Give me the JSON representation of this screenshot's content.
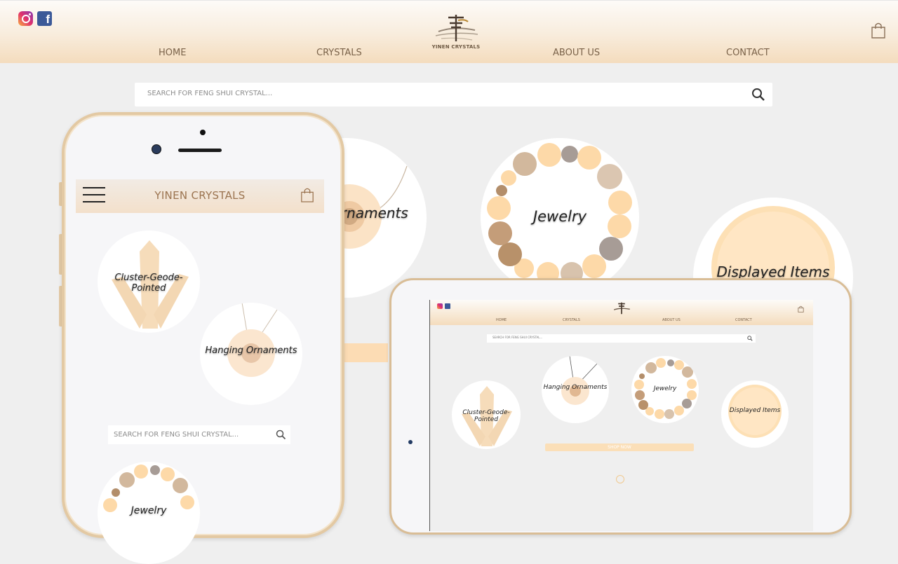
{
  "header": {
    "logo_text": "YINEN CRYSTALS",
    "nav": [
      "HOME",
      "CRYSTALS",
      "ABOUT US",
      "CONTACT"
    ]
  },
  "search": {
    "placeholder": "SEARCH FOR FENG SHUI CRYSTAL..."
  },
  "categories": [
    "Ornaments",
    "Jewelry",
    "Displayed Items"
  ],
  "phone": {
    "title": "YINEN CRYSTALS",
    "categories": [
      "Cluster-Geode-Pointed",
      "Hanging Ornaments",
      "Jewelry"
    ],
    "search_placeholder": "SEARCH FOR FENG SHUI CRYSTAL..."
  },
  "tablet": {
    "nav": [
      "HOME",
      "CRYSTALS",
      "ABOUT US",
      "CONTACT"
    ],
    "search_placeholder": "SEARCH FOR FENG SHUI CRYSTAL...",
    "categories": [
      "Cluster-Geode-Pointed",
      "Hanging Ornaments",
      "Jewelry",
      "Displayed Items"
    ],
    "shop_now": "SHOP NOW"
  },
  "colors": {
    "header_gradient_end": "#f4dcbd",
    "nav_text": "#7a6249",
    "bead_peach": "#fdd9a8",
    "bead_grey": "#a79c96"
  },
  "icons": [
    "instagram-icon",
    "facebook-icon",
    "cart-icon",
    "search-icon",
    "menu-icon"
  ]
}
